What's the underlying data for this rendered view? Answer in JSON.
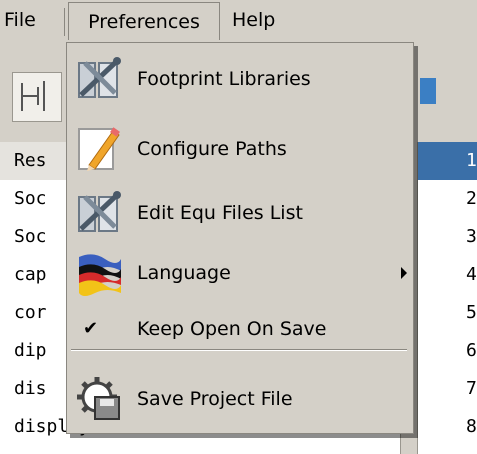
{
  "menubar": {
    "file_label": "File",
    "preferences_label": "Preferences",
    "help_label": "Help"
  },
  "preferences_menu": {
    "items": [
      {
        "label": "Footprint Libraries",
        "icon": "library-tools-icon"
      },
      {
        "label": "Configure Paths",
        "icon": "pencil-paper-icon"
      },
      {
        "label": "Edit Equ Files List",
        "icon": "library-tools-icon"
      },
      {
        "label": "Language",
        "icon": "flag-icon",
        "has_submenu": true
      },
      {
        "label": "Keep Open On Save",
        "checked": true,
        "check_glyph": "✔"
      },
      {
        "label": "Save Project File",
        "icon": "gear-save-icon"
      }
    ]
  },
  "list": {
    "rows": [
      "Res",
      "Soc",
      "Soc",
      "cap",
      "cor",
      "dip",
      "dis",
      "display"
    ],
    "numbers": [
      "1",
      "2",
      "3",
      "4",
      "5",
      "6",
      "7",
      "8"
    ]
  },
  "colors": {
    "menu_bg": "#d4d0c8",
    "selection_blue": "#3a6fa8",
    "toolbar_accent": "#3b7fc4"
  }
}
